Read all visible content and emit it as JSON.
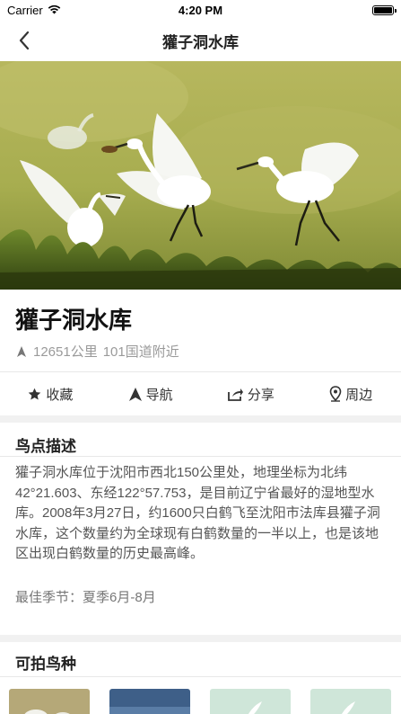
{
  "status_bar": {
    "carrier": "Carrier",
    "time": "4:20 PM"
  },
  "nav": {
    "title": "獾子洞水库"
  },
  "place": {
    "name": "獾子洞水库",
    "distance": "12651公里",
    "location": "101国道附近"
  },
  "actions": [
    {
      "label": "收藏",
      "icon": "star-icon"
    },
    {
      "label": "导航",
      "icon": "navigation-arrow-icon"
    },
    {
      "label": "分享",
      "icon": "share-icon"
    },
    {
      "label": "周边",
      "icon": "location-pin-icon"
    }
  ],
  "description": {
    "title": "鸟点描述",
    "text": "獾子洞水库位于沈阳市西北150公里处，地理坐标为北纬42°21.603、东经122°57.753，是目前辽宁省最好的湿地型水库。2008年3月27日，约1600只白鹤飞至沈阳市法库县獾子洞水库，这个数量约为全球现有白鹤数量的一半以上，也是该地区出现白鹤数量的历史最高峰。",
    "season_label": "最佳季节：",
    "season_value": "夏季6月-8月"
  },
  "bird_species": {
    "title": "可拍鸟种"
  }
}
